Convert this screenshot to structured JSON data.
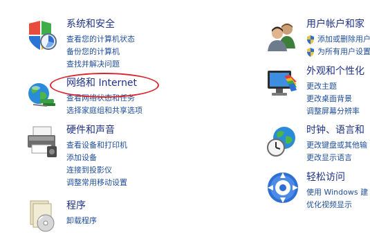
{
  "categories": {
    "system": {
      "title": "系统和安全",
      "icon": "shield-icon",
      "links": [
        "查看您的计算机状态",
        "备份您的计算机",
        "查找并解决问题"
      ]
    },
    "network": {
      "title": "网络和 Internet",
      "icon": "globe-network-icon",
      "links": [
        "查看网络状态和任务",
        "选择家庭组和共享选项"
      ]
    },
    "hardware": {
      "title": "硬件和声音",
      "icon": "printer-icon",
      "links": [
        "查看设备和打印机",
        "添加设备",
        "连接到投影仪",
        "调整常用移动设置"
      ]
    },
    "programs": {
      "title": "程序",
      "icon": "programs-icon",
      "links": [
        "卸载程序"
      ]
    },
    "users": {
      "title": "用户帐户和家",
      "icon": "users-icon",
      "links": [
        "添加或删除用户",
        "为所有用户设置"
      ]
    },
    "appearance": {
      "title": "外观和个性化",
      "icon": "monitor-paint-icon",
      "links": [
        "更改主题",
        "更改桌面背景",
        "调整屏幕分辨率"
      ]
    },
    "clock": {
      "title": "时钟、语言和",
      "icon": "clock-globe-icon",
      "links": [
        "更改键盘或其他输",
        "更改显示语言"
      ]
    },
    "ease": {
      "title": "轻松访问",
      "icon": "ease-of-access-icon",
      "links": [
        "使用 Windows 建",
        "优化视频显示"
      ]
    }
  },
  "colors": {
    "title": "#1e3287",
    "link": "#1f4e9a",
    "highlight": "#d9262c"
  }
}
